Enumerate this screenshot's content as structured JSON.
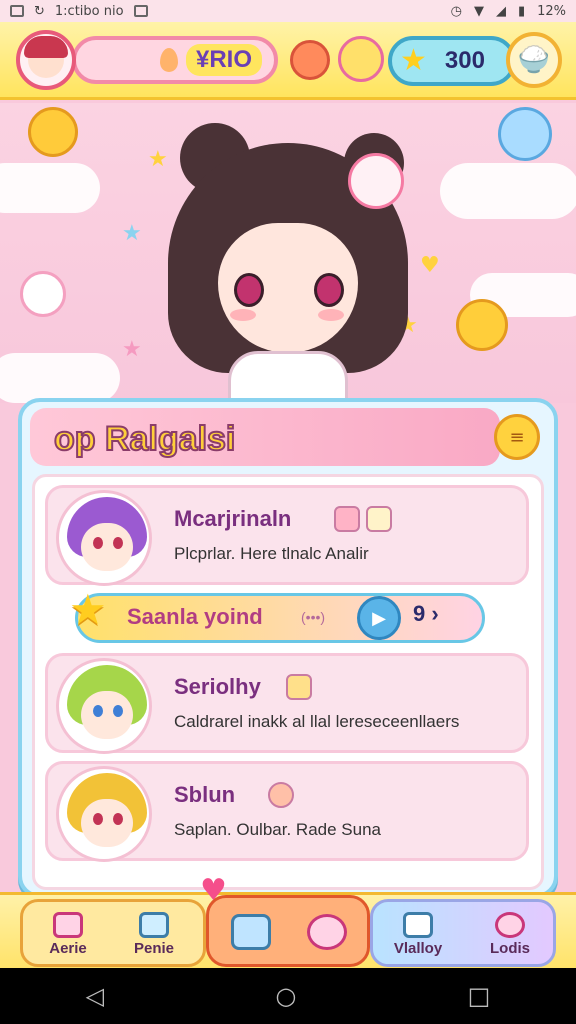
{
  "status_bar": {
    "time_text": "1:ctibo nio",
    "battery_text": "12%"
  },
  "hud": {
    "currency_value": "RIO",
    "currency_prefix": "¥",
    "stars_value": "300"
  },
  "panel": {
    "title": "op Ralgalsi",
    "entries": [
      {
        "name": "Mcarjrinaln",
        "desc": "Plcprlar. Here tlnalc Analir"
      },
      {
        "name": "Seriolhy",
        "desc": "Caldrarel inakk al llal lereseceenllaers"
      },
      {
        "name": "Sblun",
        "desc": "Saplan. Oulbar. Rade Suna"
      }
    ],
    "separator": {
      "label": "Saanla yoind",
      "sub": "(•••)",
      "count": "9"
    }
  },
  "nav": {
    "items": [
      {
        "label": "Aerie"
      },
      {
        "label": "Penie"
      },
      {
        "label": "Vlalloy"
      },
      {
        "label": "Lodis"
      }
    ]
  },
  "colors": {
    "accent_pink": "#f28aa8",
    "accent_yellow": "#ffe45e",
    "accent_blue": "#8ad3ef"
  },
  "icons": [
    "wifi-icon",
    "signal-icon",
    "battery-icon",
    "star-icon",
    "play-icon",
    "chevron-right-icon",
    "home-icon",
    "heart-icon",
    "back-icon",
    "home-circle-icon",
    "recents-icon"
  ]
}
